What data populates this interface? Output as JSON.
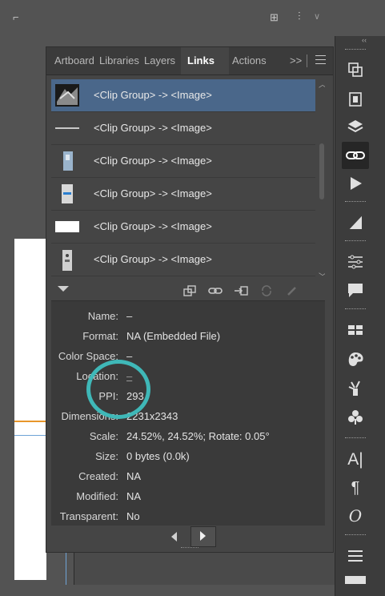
{
  "tabs": {
    "items": [
      {
        "label": "Artboards"
      },
      {
        "label": "Libraries"
      },
      {
        "label": "Layers"
      },
      {
        "label": "Links"
      },
      {
        "label": "Actions"
      }
    ],
    "more_label": ">>"
  },
  "links": [
    {
      "label": "<Clip Group> -> <Image>",
      "selected": true
    },
    {
      "label": "<Clip Group> -> <Image>",
      "selected": false
    },
    {
      "label": "<Clip Group> -> <Image>",
      "selected": false
    },
    {
      "label": "<Clip Group> -> <Image>",
      "selected": false
    },
    {
      "label": "<Clip Group> -> <Image>",
      "selected": false
    },
    {
      "label": "<Clip Group> -> <Image>",
      "selected": false
    }
  ],
  "info": {
    "name": {
      "label": "Name:",
      "value": "–"
    },
    "format": {
      "label": "Format:",
      "value": "NA (Embedded File)"
    },
    "color_space": {
      "label": "Color Space:",
      "value": "–"
    },
    "location": {
      "label": "Location:",
      "value": "–"
    },
    "ppi": {
      "label": "PPI:",
      "value": "293"
    },
    "dimensions": {
      "label": "Dimensions:",
      "value": "2231x2343"
    },
    "scale": {
      "label": "Scale:",
      "value": "24.52%, 24.52%; Rotate: 0.05°"
    },
    "size": {
      "label": "Size:",
      "value": "0 bytes (0.0k)"
    },
    "created": {
      "label": "Created:",
      "value": "NA"
    },
    "modified": {
      "label": "Modified:",
      "value": "NA"
    },
    "transparent": {
      "label": "Transparent:",
      "value": "No"
    }
  },
  "colors": {
    "highlight_circle": "#3fb8b8",
    "selection": "#4a678a",
    "accent_orange": "#e8962b"
  },
  "toolbar_icons": [
    "relink-from-library-icon",
    "relink-icon",
    "go-to-link-icon",
    "update-link-icon",
    "edit-original-icon"
  ],
  "rightbar_icons": [
    "artboards-icon",
    "libraries-icon",
    "layers-icon",
    "links-icon",
    "actions-icon",
    "appearance-icon",
    "properties-icon",
    "comments-icon",
    "swatches-icon",
    "color-icon",
    "brushes-icon",
    "symbols-icon",
    "character-icon",
    "paragraph-icon",
    "opentype-icon",
    "align-icon"
  ]
}
